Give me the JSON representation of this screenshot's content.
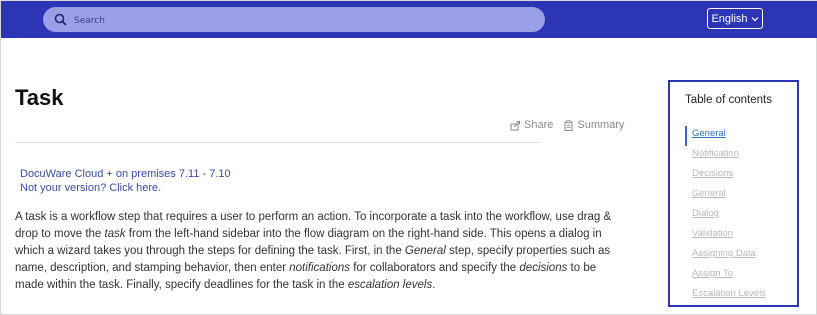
{
  "header": {
    "search": {
      "placeholder": "Search",
      "icon": "search-icon"
    },
    "language": {
      "label": "English",
      "icon": "chevron-down-icon"
    },
    "colors": {
      "bar": "#2c36b5",
      "search_bg": "#9aa0e6"
    }
  },
  "article": {
    "title": "Task",
    "actions": {
      "share_label": "Share",
      "summary_label": "Summary"
    },
    "version": {
      "line1": "DocuWare Cloud + on premises 7.11 - 7.10",
      "line2": "Not your version? Click here."
    },
    "body": {
      "p1": "A task is a workflow step that requires a user to perform an action. To incorporate a task into the workflow, use drag & drop to move the ",
      "e1": "task",
      "p2": " from the left-hand sidebar into the flow diagram on the right-hand side. This opens a dialog in which a wizard takes you through the steps for defining the task. First, in the ",
      "e2": "General",
      "p3": " step, specify properties such as name, description, and stamping behavior, then enter ",
      "e3": "notifications",
      "p4": " for collaborators and specify the ",
      "e4": "decisions",
      "p5": " to be made within the task. Finally, specify deadlines for the task in the ",
      "e5": "escalation levels",
      "p6": "."
    }
  },
  "toc": {
    "title": "Table of contents",
    "items": [
      {
        "label": "General"
      },
      {
        "label": "Notification"
      },
      {
        "label": "Decisions"
      },
      {
        "label": "General"
      },
      {
        "label": "Dialog"
      },
      {
        "label": "Validation"
      },
      {
        "label": "Assigning Data"
      },
      {
        "label": "Assign To"
      },
      {
        "label": "Escalation Levels"
      }
    ],
    "active_color": "#2c6fc9"
  }
}
